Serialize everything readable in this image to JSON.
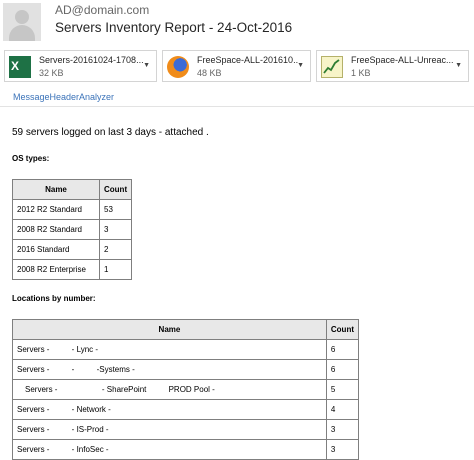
{
  "header": {
    "sender": "AD@domain.com",
    "subject": "Servers Inventory Report - 24-Oct-2016"
  },
  "attachments": [
    {
      "name": "Servers-20161024-1708....",
      "size": "32 KB",
      "icon": "excel-icon"
    },
    {
      "name": "FreeSpace-ALL-201610...",
      "size": "48 KB",
      "icon": "firefox-icon"
    },
    {
      "name": "FreeSpace-ALL-Unreac...",
      "size": "1 KB",
      "icon": "chart-icon"
    }
  ],
  "addin": "MessageHeaderAnalyzer",
  "body": {
    "intro": "59 servers logged on last 3 days - attached .",
    "os_heading": "OS types:",
    "os_table": {
      "headers": [
        "Name",
        "Count"
      ],
      "rows": [
        [
          "2012 R2 Standard",
          "53"
        ],
        [
          "2008 R2 Standard",
          "3"
        ],
        [
          "2016 Standard",
          "2"
        ],
        [
          "2008 R2 Enterprise",
          "1"
        ]
      ]
    },
    "loc_heading": "Locations by number:",
    "loc_table": {
      "headers": [
        "Name",
        "Count"
      ],
      "rows": [
        [
          "Servers -          - Lync -",
          "6"
        ],
        [
          "Servers -          -          -Systems -",
          "6"
        ],
        [
          "Servers -                    - SharePoint          PROD Pool -",
          "5"
        ],
        [
          "Servers -          - Network -",
          "4"
        ],
        [
          "Servers -          - IS-Prod -",
          "3"
        ],
        [
          "Servers -          - InfoSec -",
          "3"
        ]
      ]
    }
  }
}
